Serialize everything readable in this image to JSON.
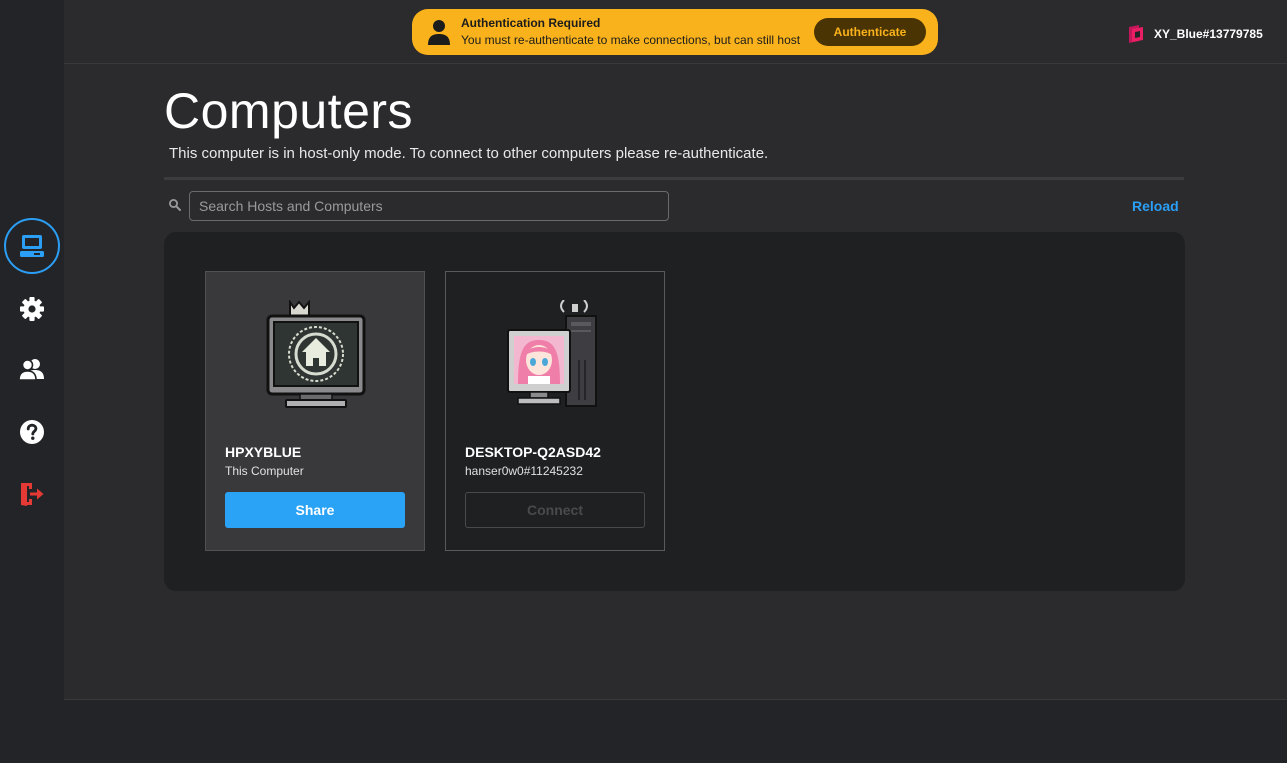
{
  "sidebar": {
    "items": [
      {
        "name": "computers",
        "icon": "laptop-icon"
      },
      {
        "name": "settings",
        "icon": "gear-icon"
      },
      {
        "name": "friends",
        "icon": "users-icon"
      },
      {
        "name": "help",
        "icon": "help-icon"
      },
      {
        "name": "logout",
        "icon": "logout-icon"
      }
    ],
    "active": "computers"
  },
  "auth_banner": {
    "title": "Authentication Required",
    "message": "You must re-authenticate to make connections, but can still host",
    "button_label": "Authenticate"
  },
  "user": {
    "name": "XY_Blue#13779785"
  },
  "page": {
    "title": "Computers",
    "subtitle": "This computer is in host-only mode. To connect to other computers please re-authenticate."
  },
  "search": {
    "placeholder": "Search Hosts and Computers",
    "value": ""
  },
  "reload_label": "Reload",
  "computers": [
    {
      "name": "HPXYBLUE",
      "subtitle": "This Computer",
      "button_label": "Share",
      "button_state": "enabled"
    },
    {
      "name": "DESKTOP-Q2ASD42",
      "subtitle": "hanser0w0#11245232",
      "button_label": "Connect",
      "button_state": "disabled"
    }
  ],
  "colors": {
    "accent": "#2b9ef5",
    "banner": "#f9b21b",
    "banner_button": "#4a3404",
    "logout": "#e53935"
  }
}
